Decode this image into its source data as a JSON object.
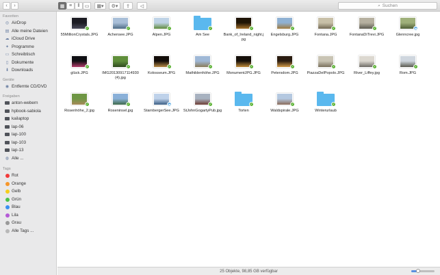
{
  "toolbar": {
    "search_placeholder": "Suchen",
    "back_icon": "chevron-left-icon",
    "forward_icon": "chevron-right-icon"
  },
  "sidebar": {
    "favorites_title": "Favoriten",
    "favorites": [
      {
        "label": "AirDrop",
        "icon": "airdrop-icon"
      },
      {
        "label": "Alle meine Dateien",
        "icon": "all-files-icon"
      },
      {
        "label": "iCloud Drive",
        "icon": "cloud-icon"
      },
      {
        "label": "Programme",
        "icon": "apps-icon"
      },
      {
        "label": "Schreibtisch",
        "icon": "desktop-icon"
      },
      {
        "label": "Dokumente",
        "icon": "documents-icon"
      },
      {
        "label": "Downloads",
        "icon": "downloads-icon"
      }
    ],
    "devices_title": "Geräte",
    "devices": [
      {
        "label": "Entfernte CD/DVD",
        "icon": "disc-icon"
      }
    ],
    "shared_title": "Freigaben",
    "shared": [
      {
        "label": "anton-webern"
      },
      {
        "label": "hpbook-sabiola"
      },
      {
        "label": "kailaptop"
      },
      {
        "label": "lap-06"
      },
      {
        "label": "lap-100"
      },
      {
        "label": "lap-103"
      },
      {
        "label": "lap-13"
      },
      {
        "label": "Alle ..."
      }
    ],
    "tags_title": "Tags",
    "tags": [
      {
        "label": "Rot",
        "color": "#f23b3b"
      },
      {
        "label": "Orange",
        "color": "#f7972a"
      },
      {
        "label": "Gelb",
        "color": "#f5cd1d"
      },
      {
        "label": "Grün",
        "color": "#4ac24a"
      },
      {
        "label": "Blau",
        "color": "#3a8ff2"
      },
      {
        "label": "Lila",
        "color": "#b45ad6"
      },
      {
        "label": "Grau",
        "color": "#9a9a9a"
      },
      {
        "label": "Alle Tags ...",
        "color": ""
      }
    ]
  },
  "files": [
    {
      "name": "55MillionCrystals.JPG",
      "kind": "photo",
      "c1": "#1b1b22",
      "c2": "#4a4a5a",
      "status": "synced"
    },
    {
      "name": "Achensee.JPG",
      "kind": "photo",
      "c1": "#a9bfd8",
      "c2": "#4d6b86",
      "status": "synced"
    },
    {
      "name": "Alpen.JPG",
      "kind": "photo",
      "c1": "#bfd3e6",
      "c2": "#5e8a3c",
      "status": "synced"
    },
    {
      "name": "Am See",
      "kind": "folder",
      "status": "synced"
    },
    {
      "name": "Bank_of_Ireland_night.jpg",
      "kind": "photo",
      "c1": "#1e1406",
      "c2": "#a3702b",
      "status": "synced"
    },
    {
      "name": "Engelsburg.JPG",
      "kind": "photo",
      "c1": "#8fb1d3",
      "c2": "#a07a3e",
      "status": "synced"
    },
    {
      "name": "Fontana.JPG",
      "kind": "photo",
      "c1": "#c8c0a8",
      "c2": "#746a55",
      "status": "synced"
    },
    {
      "name": "FontanaDiTrevi.JPG",
      "kind": "photo",
      "c1": "#b6b0a0",
      "c2": "#5d5a50",
      "status": "synced"
    },
    {
      "name": "Glenncree.jpg",
      "kind": "photo",
      "c1": "#9fb07a",
      "c2": "#4f5e36",
      "status": "cloud"
    },
    {
      "name": "glück.JPG",
      "kind": "photo",
      "c1": "#0e0e12",
      "c2": "#b33a6a",
      "status": "synced"
    },
    {
      "name": "IMG20130917114930 (4).jpg",
      "kind": "photo",
      "c1": "#5f8e3a",
      "c2": "#2f4a1e",
      "status": "synced"
    },
    {
      "name": "Kolosseum.JPG",
      "kind": "photo",
      "c1": "#120c08",
      "c2": "#b88a45",
      "status": "synced"
    },
    {
      "name": "Mathildenhöhe.JPG",
      "kind": "photo",
      "c1": "#9fb8d6",
      "c2": "#8a7a5a",
      "status": "synced"
    },
    {
      "name": "MonumentJPG.JPG",
      "kind": "photo",
      "c1": "#150f09",
      "c2": "#c08b3a",
      "status": "synced"
    },
    {
      "name": "Petersdom.JPG",
      "kind": "photo",
      "c1": "#2a1c10",
      "c2": "#d29a48",
      "status": "synced"
    },
    {
      "name": "PiazzaDelPopolo.JPG",
      "kind": "photo",
      "c1": "#c9c4b4",
      "c2": "#7a705c",
      "status": "synced"
    },
    {
      "name": "River_Liffey.jpg",
      "kind": "photo",
      "c1": "#dcd8d0",
      "c2": "#6d6a64",
      "status": "synced"
    },
    {
      "name": "Rom.JPG",
      "kind": "photo",
      "c1": "#cfd6de",
      "c2": "#5a5a50",
      "status": "synced"
    },
    {
      "name": "Rosenhöhe_2.jpg",
      "kind": "photo",
      "c1": "#6e9644",
      "c2": "#a88a5a",
      "status": "synced"
    },
    {
      "name": "Roseninsel.jpg",
      "kind": "photo",
      "c1": "#8ab0d8",
      "c2": "#3f6a4a",
      "status": "synced"
    },
    {
      "name": "StarnbergerSee.JPG",
      "kind": "photo",
      "c1": "#bfd2ea",
      "c2": "#3c5f85",
      "status": "cloud"
    },
    {
      "name": "StJohnGogartyPub.jpg",
      "kind": "photo",
      "c1": "#a8b2c0",
      "c2": "#6e3e34",
      "status": "synced"
    },
    {
      "name": "Torten",
      "kind": "folder",
      "status": "synced"
    },
    {
      "name": "Waldspirale.JPG",
      "kind": "photo",
      "c1": "#b4c8e0",
      "c2": "#8a6a58",
      "status": "synced"
    },
    {
      "name": "Winterurlaub",
      "kind": "folder",
      "status": "synced"
    }
  ],
  "statusbar": {
    "text": "25 Objekte, 98,85 GB verfügbar",
    "zoom_level": 0.3
  }
}
